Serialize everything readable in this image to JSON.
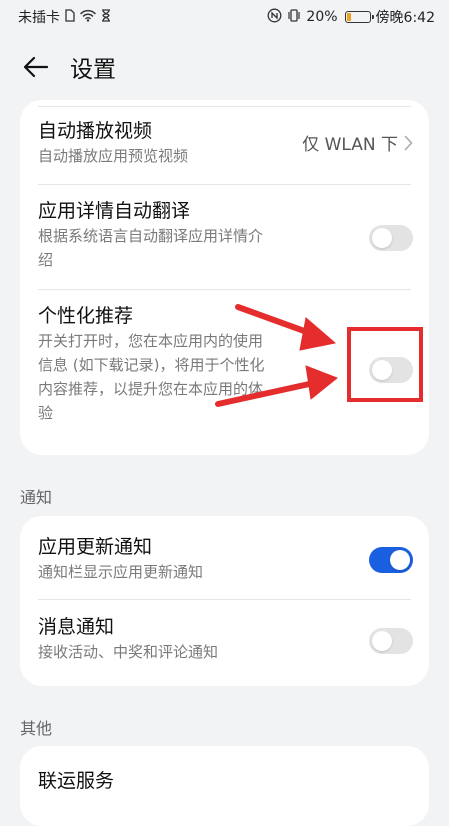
{
  "status_bar": {
    "carrier": "未插卡",
    "battery_percent": "20%",
    "battery_level": 0.2,
    "time": "傍晚6:42"
  },
  "header": {
    "title": "设置"
  },
  "card1": {
    "autoplay": {
      "title": "自动播放视频",
      "subtitle": "自动播放应用预览视频",
      "value": "仅 WLAN 下"
    },
    "auto_translate": {
      "title": "应用详情自动翻译",
      "subtitle_line1": "根据系统语言自动翻译应用详情介",
      "subtitle_line2": "绍",
      "enabled": false
    },
    "personalized": {
      "title": "个性化推荐",
      "subtitle_line1": "开关打开时，您在本应用内的使用",
      "subtitle_line2": "信息 (如下载记录)，将用于个性化",
      "subtitle_line3": "内容推荐，以提升您在本应用的体",
      "subtitle_line4": "验",
      "enabled": false
    }
  },
  "notify_section": {
    "label": "通知",
    "app_update": {
      "title": "应用更新通知",
      "subtitle": "通知栏显示应用更新通知",
      "enabled": true
    },
    "message": {
      "title": "消息通知",
      "subtitle": "接收活动、中奖和评论通知",
      "enabled": false
    }
  },
  "other_section": {
    "label": "其他",
    "joint_service": {
      "title": "联运服务"
    }
  },
  "colors": {
    "accent": "#1a5fe0",
    "annotation": "#e52d2d",
    "background": "#f1f3f5"
  }
}
